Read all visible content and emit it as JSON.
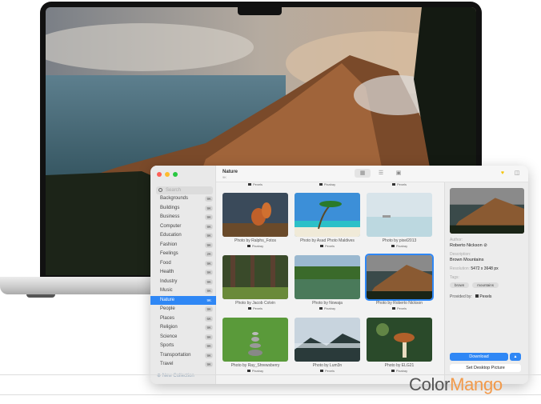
{
  "sidebar": {
    "search_placeholder": "Search",
    "items": [
      {
        "label": "Backgrounds",
        "count": "9K"
      },
      {
        "label": "Buildings",
        "count": "9K"
      },
      {
        "label": "Business",
        "count": "9K"
      },
      {
        "label": "Computer",
        "count": "9K"
      },
      {
        "label": "Education",
        "count": "9K"
      },
      {
        "label": "Fashion",
        "count": "9K"
      },
      {
        "label": "Feelings",
        "count": "2K"
      },
      {
        "label": "Food",
        "count": "9K"
      },
      {
        "label": "Health",
        "count": "9K"
      },
      {
        "label": "Industry",
        "count": "9K"
      },
      {
        "label": "Music",
        "count": "9K"
      },
      {
        "label": "Nature",
        "count": "9K",
        "selected": true
      },
      {
        "label": "People",
        "count": "9K"
      },
      {
        "label": "Places",
        "count": "6K"
      },
      {
        "label": "Religion",
        "count": "9K"
      },
      {
        "label": "Science",
        "count": "9K"
      },
      {
        "label": "Sports",
        "count": "9K"
      },
      {
        "label": "Transportation",
        "count": "9K"
      },
      {
        "label": "Travel",
        "count": "9K"
      }
    ],
    "new_collection": "New Collection"
  },
  "header": {
    "title": "Nature",
    "subtitle": "9K",
    "views": [
      "grid-icon",
      "list-icon",
      "image-icon"
    ]
  },
  "grid": {
    "top_sources": [
      "Pexels",
      "Pixabay",
      "Pexels"
    ],
    "photos": [
      {
        "caption": "Photo by Ralphs_Fotos",
        "source": "Pixabay",
        "scene": "squirrel"
      },
      {
        "caption": "Photo by Asad Photo Maldives",
        "source": "Pexels",
        "scene": "beach"
      },
      {
        "caption": "Photo by pixel2013",
        "source": "Pixabay",
        "scene": "mist"
      },
      {
        "caption": "Photo by Jacob Colvin",
        "source": "Pexels",
        "scene": "forest"
      },
      {
        "caption": "Photo by Nowaja",
        "source": "Pixabay",
        "scene": "lake"
      },
      {
        "caption": "Photo by Roberto Nickson",
        "source": "Pexels",
        "scene": "mountain",
        "selected": true
      },
      {
        "caption": "Photo by Ray_Shrewsberry",
        "source": "Pixabay",
        "scene": "stones"
      },
      {
        "caption": "Photo by Lum3n",
        "source": "Pexels",
        "scene": "fog"
      },
      {
        "caption": "Photo by ELG21",
        "source": "Pixabay",
        "scene": "mushroom"
      }
    ]
  },
  "detail": {
    "author_label": "Author:",
    "author": "Roberto Nickson",
    "description_label": "Description:",
    "description": "Brown Mountains",
    "resolution_label": "Resolution:",
    "resolution": "5472 x 3648 px",
    "tags_label": "Tags:",
    "tags": [
      "brown",
      "mountains"
    ],
    "provided_label": "Provided by:",
    "provider": "Pexels",
    "download": "Download",
    "set_desktop": "Set Desktop Picture"
  },
  "watermark": {
    "part1": "Color",
    "part2": "Mango",
    ".com": ".com"
  },
  "colors": {
    "accent": "#2f87f5",
    "watermark_orange": "#f29a4a"
  }
}
